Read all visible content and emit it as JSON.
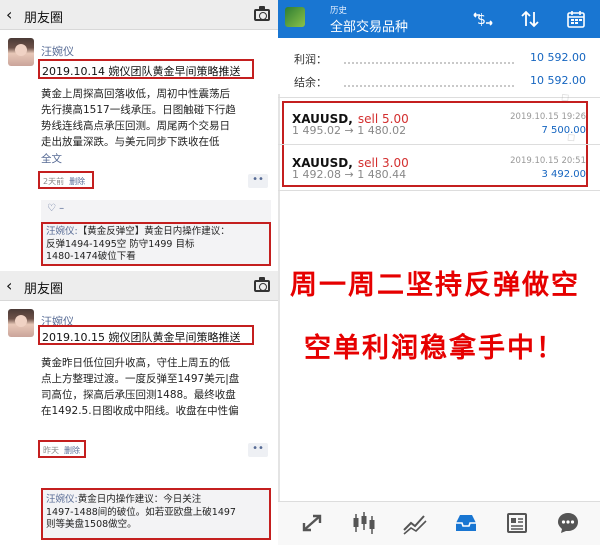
{
  "moments": [
    {
      "title": "朋友圈",
      "name": "汪婉仪",
      "headline": "2019.10.14 婉仪团队黄金早间策略推送",
      "body": [
        "黄金上周探高回落收低，周初中性震荡后",
        "先行摸高1517一线承压。日图触碰下行趋",
        "势线连线高点承压回测。周尾两个交易日",
        "走出放量深跌。与美元同步下跌收在低"
      ],
      "full_text": "全文",
      "time": "2天前",
      "delete": "删除",
      "more": "••",
      "like": "♡ –",
      "comment_name": "汪婉仪:",
      "comment_lines": [
        "【黄金反弹空】黄金日内操作建议：",
        "反弹1494-1495空  防守1499  目标",
        "1480-1474破位下看"
      ]
    },
    {
      "title": "朋友圈",
      "name": "汪婉仪",
      "headline": "2019.10.15 婉仪团队黄金早间策略推送",
      "body": [
        "黄金昨日低位回升收高，守住上周五的低",
        "点上方整理过渡。一度反弹至1497美元|盘",
        "司高位，探高后承压回测1488。最终收盘",
        "在1492.5.日图收成中阳线。收盘在中性偏"
      ],
      "time": "昨天",
      "delete": "删除",
      "more": "••",
      "comment_name": "汪婉仪:",
      "comment_lines": [
        "黄金日内操作建议：今日关注",
        "1497-1488间的破位。如若亚欧盘上破1497",
        "则等美盘1508做空。"
      ]
    }
  ],
  "mt4": {
    "subtitle": "历史",
    "title": "全部交易品种",
    "icons": [
      "money-exchange-icon",
      "sort-icon",
      "calendar-icon"
    ],
    "profit_label": "利润：",
    "profit_value": "10 592.00",
    "balance_label": "结余：",
    "balance_value": "10 592.00",
    "trades": [
      {
        "symbol": "XAUUSD,",
        "side": "sell 5.00",
        "prices": "1 495.02 → 1 480.02",
        "time": "2019.10.15 19:26",
        "profit": "7 500.00"
      },
      {
        "symbol": "XAUUSD,",
        "side": "sell 3.00",
        "prices": "1 492.08 → 1 480.44",
        "time": "2019.10.15 20:51",
        "profit": "3 492.00"
      }
    ],
    "footer_icons": [
      "trade-icon",
      "chart-candles-icon",
      "line-chart-icon",
      "inbox-icon",
      "news-icon",
      "chat-icon"
    ]
  },
  "overlay": {
    "line1": "周一周二坚持反弹做空",
    "line2": "空单利润稳拿手中！"
  },
  "colors": {
    "mt_blue": "#1976d2",
    "highlight_red": "#c41f1f",
    "overlay_red": "#e60000",
    "wechat_link": "#576b95"
  }
}
